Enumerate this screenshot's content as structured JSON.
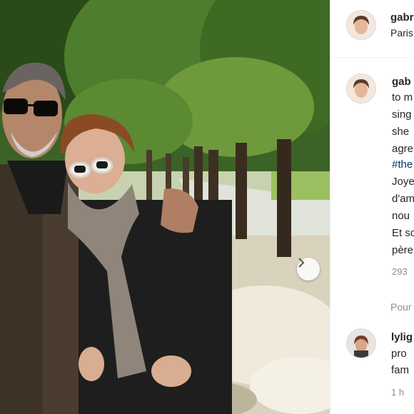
{
  "header": {
    "username": "gabr",
    "location": "Paris"
  },
  "caption": {
    "username": "gab",
    "lines": [
      "to m",
      "sing",
      "she",
      "agre",
      "Joye",
      "d'am",
      "nou",
      "Et so",
      "père"
    ],
    "hashtag": "#the",
    "meta": "293"
  },
  "reply_section": {
    "view_replies": "Pour"
  },
  "comment": {
    "username": "lylig",
    "lines": [
      "pro",
      "fam"
    ],
    "time": "1 h"
  },
  "icons": {
    "next": "chevron-right-icon"
  },
  "colors": {
    "hashtag": "#00376b",
    "muted": "#8e8e8e",
    "text": "#262626",
    "divider": "#efefef"
  }
}
